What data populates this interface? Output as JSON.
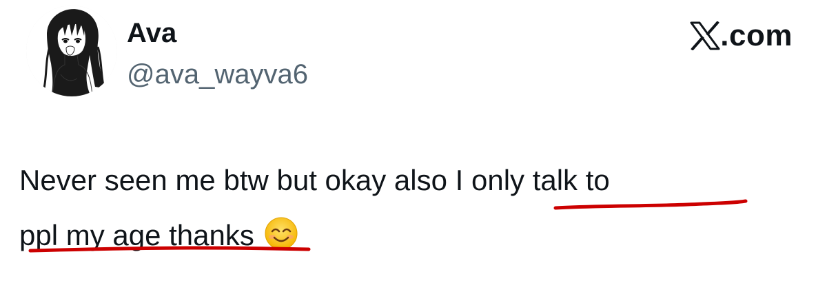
{
  "author": {
    "display_name": "Ava",
    "handle": "@ava_wayva6",
    "avatar_icon": "anime-girl-avatar"
  },
  "brand": {
    "logo_icon": "x-logo-icon",
    "text": ".com"
  },
  "tweet": {
    "line1_plain": "Never seen me btw but okay also I ",
    "line1_highlight": "only talk to",
    "line2_highlight": "ppl my age thanks",
    "emoji": "😊",
    "emoji_icon": "smiling-face-emoji"
  },
  "annotation": {
    "underline_color": "#cc0000"
  }
}
